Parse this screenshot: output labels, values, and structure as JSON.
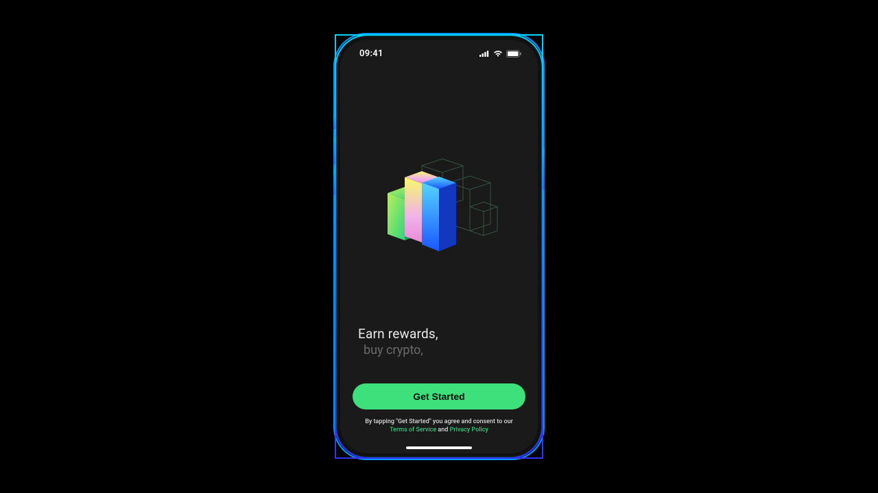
{
  "status": {
    "time": "09:41"
  },
  "headline": {
    "line1": "Earn rewards,",
    "line2": "buy crypto,"
  },
  "cta": {
    "label": "Get Started"
  },
  "legal": {
    "prefix": "By tapping \"Get Started\" you agree and consent to our",
    "tos": "Terms of Service",
    "and": " and ",
    "privacy": "Privacy Policy"
  },
  "colors": {
    "accent": "#3de07a",
    "link": "#34c77b"
  }
}
